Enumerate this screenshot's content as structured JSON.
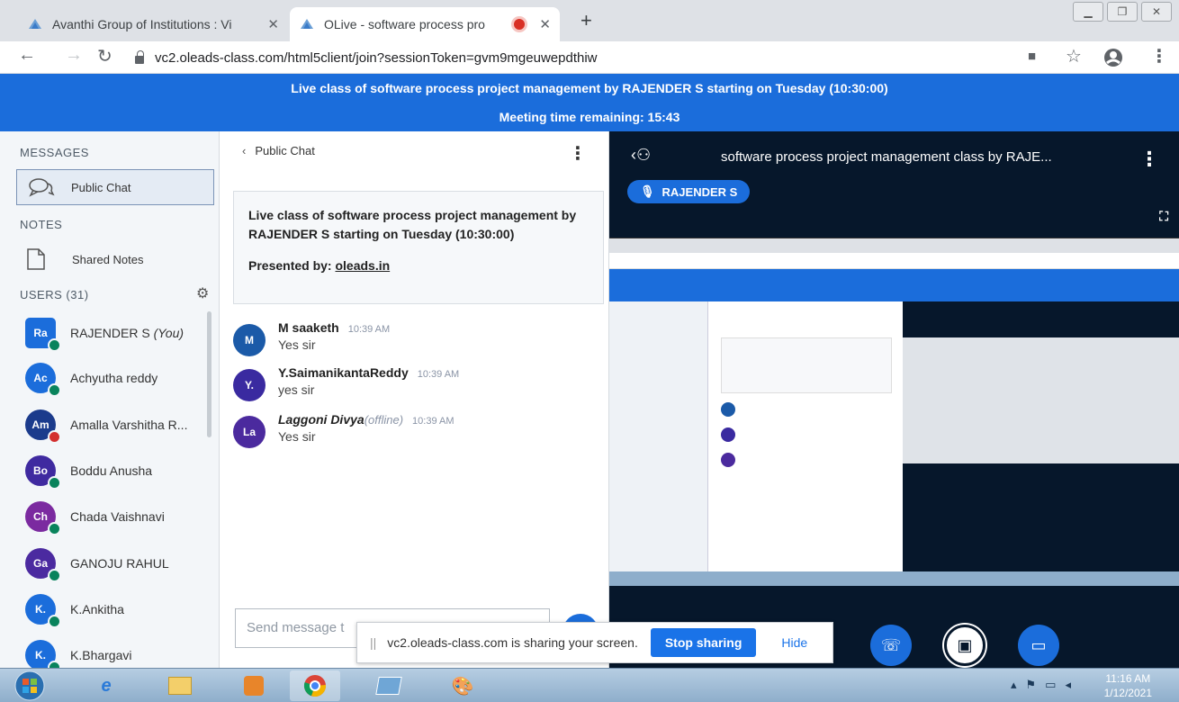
{
  "browser": {
    "tabs": [
      {
        "title": "Avanthi Group of Institutions : Vi",
        "active": false
      },
      {
        "title": "OLive - software process pro",
        "active": true
      }
    ],
    "new_tab": "+",
    "url": "vc2.oleads-class.com/html5client/join?sessionToken=gvm9mgeuwepdthiw"
  },
  "banner": {
    "title": "Live class of software process project management by RAJENDER S starting on Tuesday (10:30:00)",
    "time_remaining": "Meeting time remaining: 15:43"
  },
  "sidebar": {
    "messages_heading": "MESSAGES",
    "public_chat": "Public Chat",
    "notes_heading": "NOTES",
    "shared_notes": "Shared Notes",
    "users_heading": "USERS (31)",
    "users": [
      {
        "initials": "Ra",
        "name": "RAJENDER S",
        "suffix": "(You)",
        "color": "#1b6ddb"
      },
      {
        "initials": "Ac",
        "name": "Achyutha reddy",
        "color": "#1b6ddb"
      },
      {
        "initials": "Am",
        "name": "Amalla Varshitha R...",
        "color": "#1b3b8c"
      },
      {
        "initials": "Bo",
        "name": "Boddu Anusha",
        "color": "#3f2aa0"
      },
      {
        "initials": "Ch",
        "name": "Chada Vaishnavi",
        "color": "#7b2aa0"
      },
      {
        "initials": "Ga",
        "name": "GANOJU RAHUL",
        "color": "#4b2aa0"
      },
      {
        "initials": "K.",
        "name": "K.Ankitha",
        "color": "#1b6ddb"
      },
      {
        "initials": "K.",
        "name": "K.Bhargavi",
        "color": "#1b6ddb"
      }
    ]
  },
  "chat": {
    "header": "Public Chat",
    "welcome_text": "Live class of software process project management by RAJENDER S starting on Tuesday (10:30:00)",
    "presented_by": "Presented by: ",
    "presenter_link": "oleads.in",
    "messages": [
      {
        "initials": "M",
        "author": "M saaketh",
        "time": "10:39 AM",
        "text": "Yes sir",
        "color": "#1b5aa8"
      },
      {
        "initials": "Y.",
        "author": "Y.SaimanikantaReddy",
        "time": "10:39 AM",
        "text": "yes sir",
        "color": "#3a2aa0"
      },
      {
        "initials": "La",
        "author": "Laggoni Divya",
        "status": "(offline)",
        "time": "10:39 AM",
        "text": "Yes sir",
        "color": "#4b2a9e"
      }
    ],
    "input_placeholder": "Send message t"
  },
  "presentation": {
    "title": "software process project management class by RAJE...",
    "speaker": "RAJENDER S"
  },
  "share_notice": {
    "text": "vc2.oleads-class.com is sharing your screen.",
    "stop": "Stop sharing",
    "hide": "Hide"
  },
  "taskbar": {
    "time": "11:16 AM",
    "date": "1/12/2021"
  }
}
